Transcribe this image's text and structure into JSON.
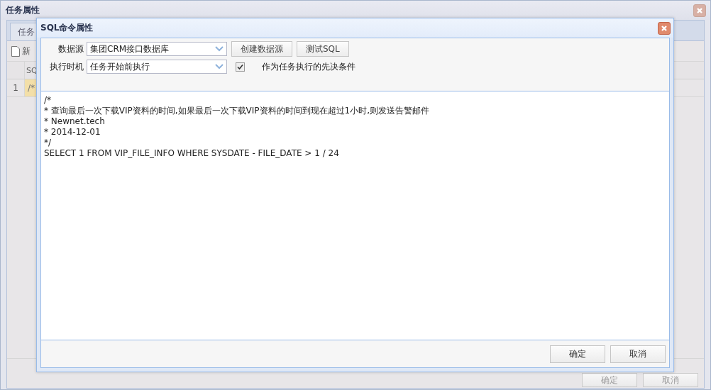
{
  "background_window": {
    "title": "任务属性",
    "tabs": [
      {
        "label": "任务",
        "selected": true
      }
    ],
    "toolbar": [
      "新"
    ],
    "grid": {
      "columns": [
        "SQ"
      ],
      "rows": [
        {
          "number": "1",
          "cells": [
            "/*"
          ],
          "selected": true
        }
      ]
    },
    "buttons": [
      "确定",
      "取消"
    ]
  },
  "dialog": {
    "title": "SQL命令属性",
    "fields": [
      {
        "label": "数据源",
        "value": "集团CRM接口数据库"
      },
      {
        "label": "执行时机",
        "value": "任务开始前执行"
      }
    ],
    "field_buttons": [
      "创建数据源",
      "测试SQL"
    ],
    "checkbox": {
      "label": "作为任务执行的先决条件",
      "checked": true
    },
    "editor_lines": [
      "/*",
      "* 查询最后一次下载VIP资料的时间,如果最后一次下载VIP资料的时间到现在超过1小时,则发送告警邮件",
      "* Newnet.tech",
      "* 2014-12-01",
      "*/",
      "SELECT 1 FROM VIP_FILE_INFO WHERE SYSDATE - FILE_DATE > 1 / 24"
    ],
    "buttons": [
      "确定",
      "取消"
    ]
  }
}
